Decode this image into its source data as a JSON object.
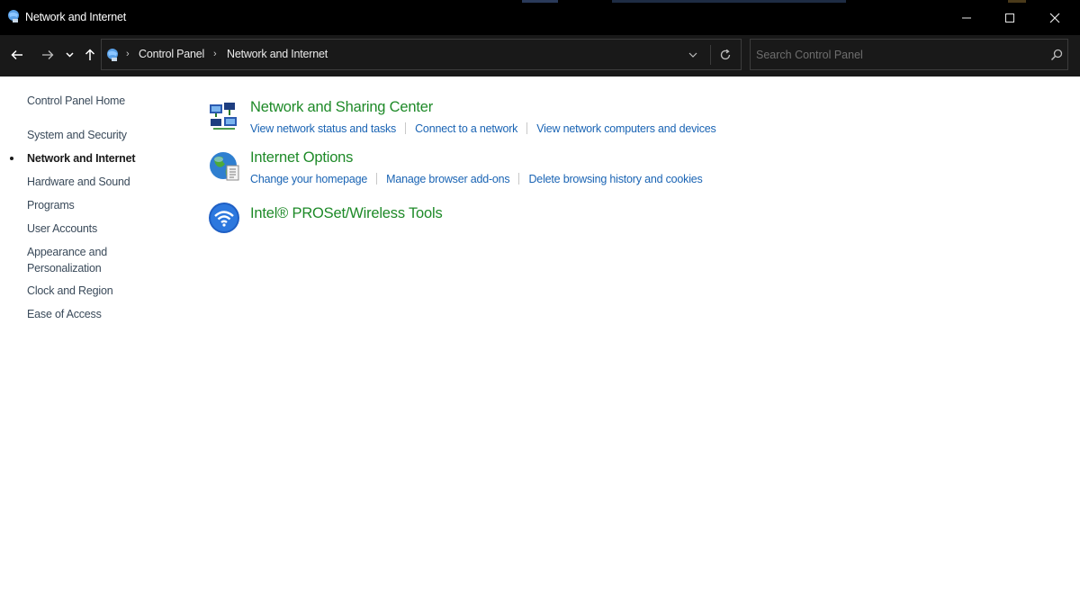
{
  "window": {
    "title": "Network and Internet",
    "controls": {
      "minimize_icon": "minimize-icon",
      "maximize_icon": "maximize-icon",
      "close_icon": "close-icon"
    }
  },
  "navigation": {
    "back_icon": "back-arrow-icon",
    "forward_icon": "forward-arrow-icon",
    "recent_icon": "chevron-down-icon",
    "up_icon": "up-arrow-icon"
  },
  "address": {
    "location_icon": "control-panel-icon",
    "breadcrumbs": [
      "Control Panel",
      "Network and Internet"
    ],
    "dropdown_icon": "chevron-down-icon",
    "refresh_icon": "refresh-icon"
  },
  "search": {
    "placeholder": "Search Control Panel",
    "value": "",
    "icon": "search-icon"
  },
  "sidebar": {
    "items": [
      {
        "label": "Control Panel Home",
        "active": false
      },
      {
        "label": "System and Security",
        "active": false
      },
      {
        "label": "Network and Internet",
        "active": true
      },
      {
        "label": "Hardware and Sound",
        "active": false
      },
      {
        "label": "Programs",
        "active": false
      },
      {
        "label": "User Accounts",
        "active": false
      },
      {
        "label": "Appearance and Personalization",
        "active": false
      },
      {
        "label": "Clock and Region",
        "active": false
      },
      {
        "label": "Ease of Access",
        "active": false
      }
    ]
  },
  "categories": [
    {
      "title": "Network and Sharing Center",
      "icon": "network-sharing-icon",
      "links": [
        "View network status and tasks",
        "Connect to a network",
        "View network computers and devices"
      ]
    },
    {
      "title": "Internet Options",
      "icon": "globe-icon",
      "links": [
        "Change your homepage",
        "Manage browser add-ons",
        "Delete browsing history and cookies"
      ]
    },
    {
      "title": "Intel® PROSet/Wireless Tools",
      "icon": "wireless-icon",
      "links": []
    }
  ],
  "colors": {
    "titlebar": "#000000",
    "navbar": "#191919",
    "category_title": "#1e8a28",
    "link": "#1a64b4",
    "sidebar_text": "#3a4a5a"
  }
}
